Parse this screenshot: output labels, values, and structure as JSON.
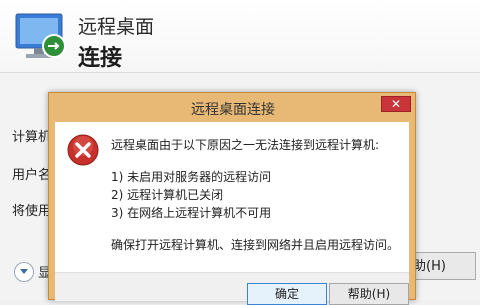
{
  "background_window": {
    "title": "远程桌面",
    "subtitle": "连接",
    "labels": [
      "计算机",
      "用户名",
      "将使用"
    ],
    "options_label": "显",
    "help_label": "助(H)"
  },
  "dialog": {
    "title": "远程桌面连接",
    "close_label": "✕",
    "message_intro": "远程桌面由于以下原因之一无法连接到远程计算机:",
    "reasons": [
      "1) 未启用对服务器的远程访问",
      "2) 远程计算机已关闭",
      "3) 在网络上远程计算机不可用"
    ],
    "advice": "确保打开远程计算机、连接到网络并且启用远程访问。",
    "ok_label": "确定",
    "help_label": "帮助(H)"
  },
  "colors": {
    "dialog_frame": "#e8b975",
    "close_button": "#c7343a",
    "error_icon": "#c8312b"
  }
}
